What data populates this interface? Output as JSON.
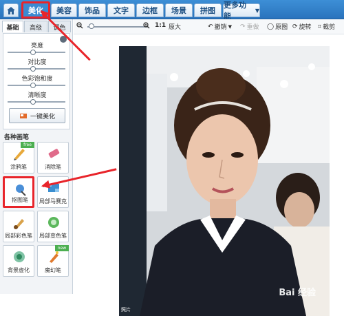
{
  "menubar": {
    "home_icon": "home-icon",
    "tabs": [
      "美化",
      "美容",
      "饰品",
      "文字",
      "边框",
      "场景",
      "拼图"
    ],
    "more": "更多功能"
  },
  "left_panel": {
    "subtabs": [
      "基础",
      "高级",
      "调色"
    ],
    "sliders": [
      {
        "label": "亮度",
        "value": 0.5
      },
      {
        "label": "对比度",
        "value": 0.5
      },
      {
        "label": "色彩饱和度",
        "value": 0.5
      },
      {
        "label": "清晰度",
        "value": 0.5
      }
    ],
    "one_key_button": "一键美化",
    "brush_section_title": "各种画笔",
    "tools": [
      {
        "label": "涂鸦笔",
        "badge": "free"
      },
      {
        "label": "消除笔",
        "badge": ""
      },
      {
        "label": "抠图笔",
        "badge": ""
      },
      {
        "label": "局部马赛克",
        "badge": ""
      },
      {
        "label": "局部彩色笔",
        "badge": ""
      },
      {
        "label": "局部变色笔",
        "badge": ""
      },
      {
        "label": "背景虚化",
        "badge": ""
      },
      {
        "label": "魔幻笔",
        "badge": "new"
      }
    ]
  },
  "toolbar": {
    "ratio": "1:1",
    "original_size": "原大",
    "undo": "撤销",
    "redo": "重做",
    "original_image": "原图",
    "rotate": "旋转",
    "crop": "裁剪"
  },
  "canvas": {
    "watermark": "Bai 经验",
    "corner_text": "照片"
  },
  "colors": {
    "menubar": "#2a73bd",
    "highlight": "#e8242a"
  }
}
